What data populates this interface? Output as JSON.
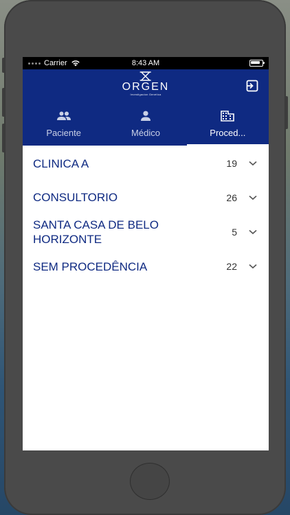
{
  "status_bar": {
    "carrier": "Carrier",
    "time": "8:43 AM"
  },
  "header": {
    "logo_text": "ORGEN",
    "logo_subtitle": "Investigacion Genetica",
    "exit_icon": "exit-icon"
  },
  "tabs": [
    {
      "label": "Paciente",
      "icon": "people-icon",
      "active": false
    },
    {
      "label": "Médico",
      "icon": "person-icon",
      "active": false
    },
    {
      "label": "Proced...",
      "icon": "building-icon",
      "active": true
    }
  ],
  "list": {
    "items": [
      {
        "name": "CLINICA A",
        "count": "19"
      },
      {
        "name": "CONSULTORIO",
        "count": "26"
      },
      {
        "name": "SANTA CASA DE BELO HORIZONTE",
        "count": "5"
      },
      {
        "name": "SEM PROCEDÊNCIA",
        "count": "22"
      }
    ]
  },
  "colors": {
    "primary": "#0f2a82",
    "text": "#0f2a82",
    "background": "#ffffff"
  }
}
